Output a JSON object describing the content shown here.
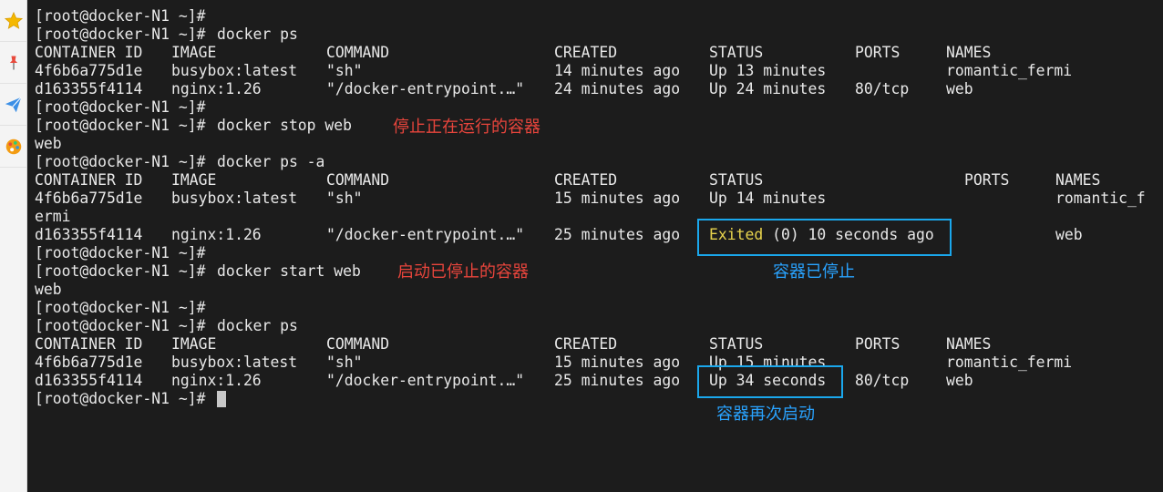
{
  "sidebar": {
    "items": [
      {
        "icon": "star-icon"
      },
      {
        "icon": "pin-icon"
      },
      {
        "icon": "send-icon"
      },
      {
        "icon": "palette-icon"
      }
    ]
  },
  "terminal": {
    "prompt": "[root@docker-N1 ~]#",
    "commands": {
      "ps": "docker ps",
      "stop": "docker stop web",
      "ps_all": "docker ps -a",
      "start": "docker start web"
    },
    "outputs": {
      "stop_result": "web",
      "start_result": "web"
    },
    "headers": {
      "container_id": "CONTAINER ID",
      "image": "IMAGE",
      "command": "COMMAND",
      "created": "CREATED",
      "status": "STATUS",
      "ports": "PORTS",
      "names": "NAMES"
    },
    "tables": [
      {
        "rows": [
          {
            "id": "4f6b6a775d1e",
            "image": "busybox:latest",
            "command": "\"sh\"",
            "created": "14 minutes ago",
            "status": "Up 13 minutes",
            "ports": "",
            "names": "romantic_fermi"
          },
          {
            "id": "d163355f4114",
            "image": "nginx:1.26",
            "command": "\"/docker-entrypoint.…\"",
            "created": "24 minutes ago",
            "status": "Up 24 minutes",
            "ports": "80/tcp",
            "names": "web"
          }
        ]
      },
      {
        "rows": [
          {
            "id": "4f6b6a775d1e",
            "image": "busybox:latest",
            "command": "\"sh\"",
            "created": "15 minutes ago",
            "status": "Up 14 minutes",
            "ports": "",
            "names_part1": "romantic_f",
            "names_part2": "ermi"
          },
          {
            "id": "d163355f4114",
            "image": "nginx:1.26",
            "command": "\"/docker-entrypoint.…\"",
            "created": "25 minutes ago",
            "status_keyword": "Exited",
            "status_rest": " (0) 10 seconds ago",
            "ports": "",
            "names": "web"
          }
        ]
      },
      {
        "rows": [
          {
            "id": "4f6b6a775d1e",
            "image": "busybox:latest",
            "command": "\"sh\"",
            "created": "15 minutes ago",
            "status": "Up 15 minutes",
            "ports": "",
            "names": "romantic_fermi"
          },
          {
            "id": "d163355f4114",
            "image": "nginx:1.26",
            "command": "\"/docker-entrypoint.…\"",
            "created": "25 minutes ago",
            "status": "Up 34 seconds",
            "ports": "80/tcp",
            "names": "web"
          }
        ]
      }
    ]
  },
  "annotations": {
    "stop_note": "停止正在运行的容器",
    "start_note": "启动已停止的容器",
    "stopped_note": "容器已停止",
    "restarted_note": "容器再次启动"
  },
  "colors": {
    "terminal_bg": "#1c1c1c",
    "terminal_text": "#e8e8e8",
    "exited_text": "#e8d44d",
    "annotation_red": "#e8453c",
    "annotation_blue": "#29a3ff",
    "highlight_border": "#1aa7ec"
  }
}
